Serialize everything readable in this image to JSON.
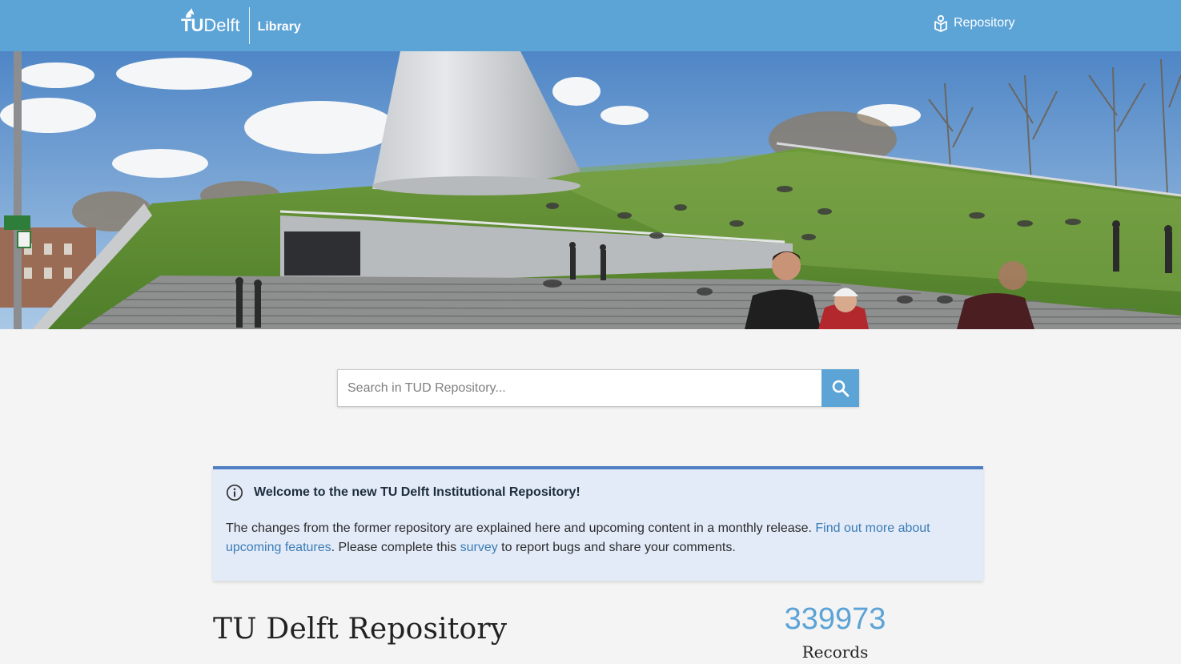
{
  "header": {
    "logo_tu": "TU",
    "logo_delft": "Delft",
    "logo_section": "Library",
    "repository_link": "Repository",
    "bar_color": "#5ca3d6"
  },
  "hero": {
    "image": "photo-tu-delft-library-green-roof-cone"
  },
  "search": {
    "placeholder": "Search in TUD Repository...",
    "value": "",
    "button_icon": "search-icon"
  },
  "notice": {
    "icon": "info-icon",
    "title": "Welcome to the new TU Delft Institutional Repository!",
    "text_1": "The changes from the former repository are explained here and upcoming content in a monthly release. ",
    "link_features": "Find out more about upcoming features",
    "text_2": ". Please complete this ",
    "link_survey": "survey",
    "text_3": " to report bugs and share your comments.",
    "accent_color": "#4f7fc2"
  },
  "main": {
    "title": "TU Delft Repository",
    "records_count": "339973",
    "records_label": "Records"
  }
}
